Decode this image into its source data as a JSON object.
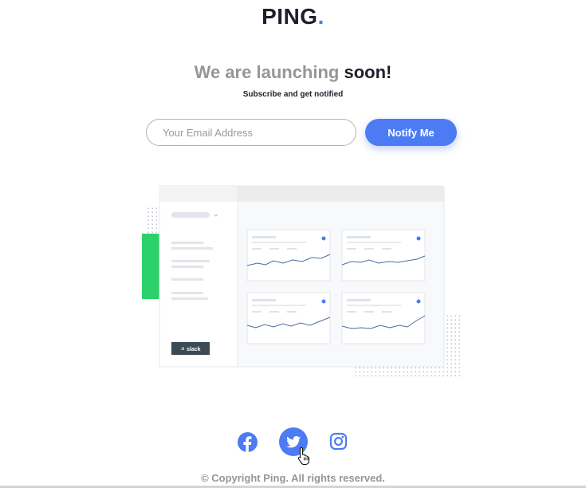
{
  "header": {
    "logo_text": "PING",
    "logo_dot": "."
  },
  "hero": {
    "headline_light": "We are launching",
    "headline_strong": "soon!",
    "subtitle": "Subscribe and get notified"
  },
  "form": {
    "email_placeholder": "Your Email Address",
    "notify_label": "Notify Me"
  },
  "illustration": {
    "sidebar_app_label": "slack"
  },
  "social": {
    "icons": [
      "facebook-icon",
      "twitter-icon",
      "instagram-icon"
    ]
  },
  "footer": {
    "copyright": "© Copyright Ping. All rights reserved."
  },
  "colors": {
    "brand_blue": "#4c7bf3",
    "dark_text": "#1d1f2b",
    "gray_text": "#969696",
    "accent_green": "#2bd16b"
  }
}
